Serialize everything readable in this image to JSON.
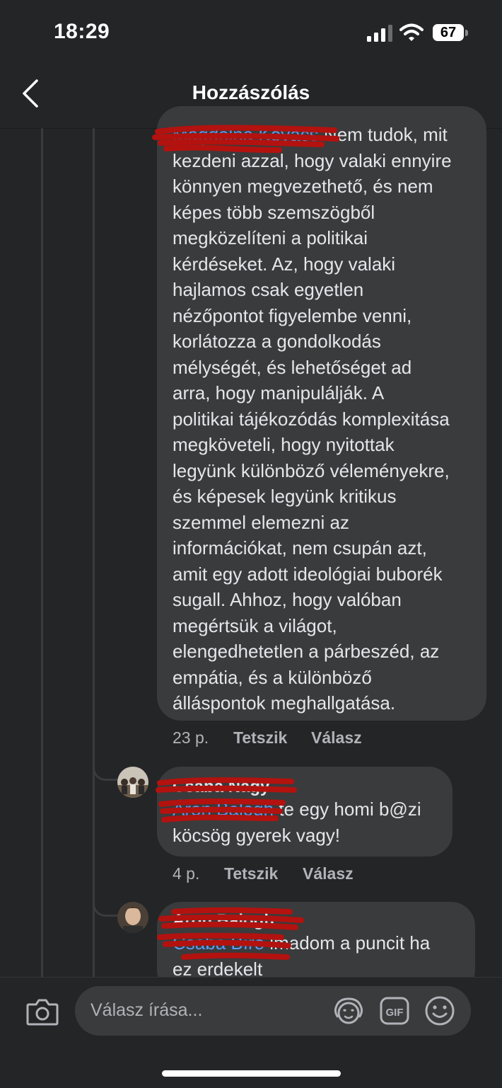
{
  "status_bar": {
    "time": "18:29",
    "battery": "67"
  },
  "header": {
    "title": "Hozzászólás"
  },
  "comments": [
    {
      "mention": "Magdolna Kovács",
      "body": " Nem tudok, mit\nkezdeni azzal, hogy valaki ennyire\nkönnyen megvezethető, és nem\nképes több szemszögből\nmegközelíteni a politikai\nkérdéseket. Az, hogy valaki\nhajlamos csak egyetlen\nnézőpontot figyelembe venni,\nkorlátozza a gondolkodás\nmélységét, és lehetőséget ad\narra, hogy manipulálják. A\npolitikai tájékozódás komplexitása\nmegköveteli, hogy nyitottak\nlegyünk különböző véleményekre,\nés képesek legyünk kritikus\nszemmel elemezni az\ninformációkat, nem csupán azt,\namit egy adott ideológiai buborék\nsugall. Ahhoz, hogy valóban\nmegértsük a világot,\nelengedhetetlen a párbeszéd, az\nempátia, és a különböző\nálláspontok meghallgatása.",
      "time": "23 p.",
      "like": "Tetszik",
      "reply": "Válasz"
    },
    {
      "author": "Csaba Nagy",
      "mention": "Áron Balogh",
      "body": " te egy homi b@zi\nköcsög gyerek vagy!",
      "time": "4 p.",
      "like": "Tetszik",
      "reply": "Válasz"
    },
    {
      "author": "Áron Balogh",
      "mention": "Csaba Bíró",
      "body": " imadom a puncit ha\nez erdekelt"
    }
  ],
  "composer": {
    "placeholder": "Válasz írása..."
  },
  "colors": {
    "background": "#242526",
    "bubble": "#3a3b3c",
    "mention": "#5b9bf3",
    "redaction": "#b3120f"
  },
  "icons": [
    "back-chevron-icon",
    "signal-icon",
    "wifi-icon",
    "battery-icon",
    "camera-icon",
    "avatar-sticker-icon",
    "gif-icon",
    "emoji-icon"
  ]
}
